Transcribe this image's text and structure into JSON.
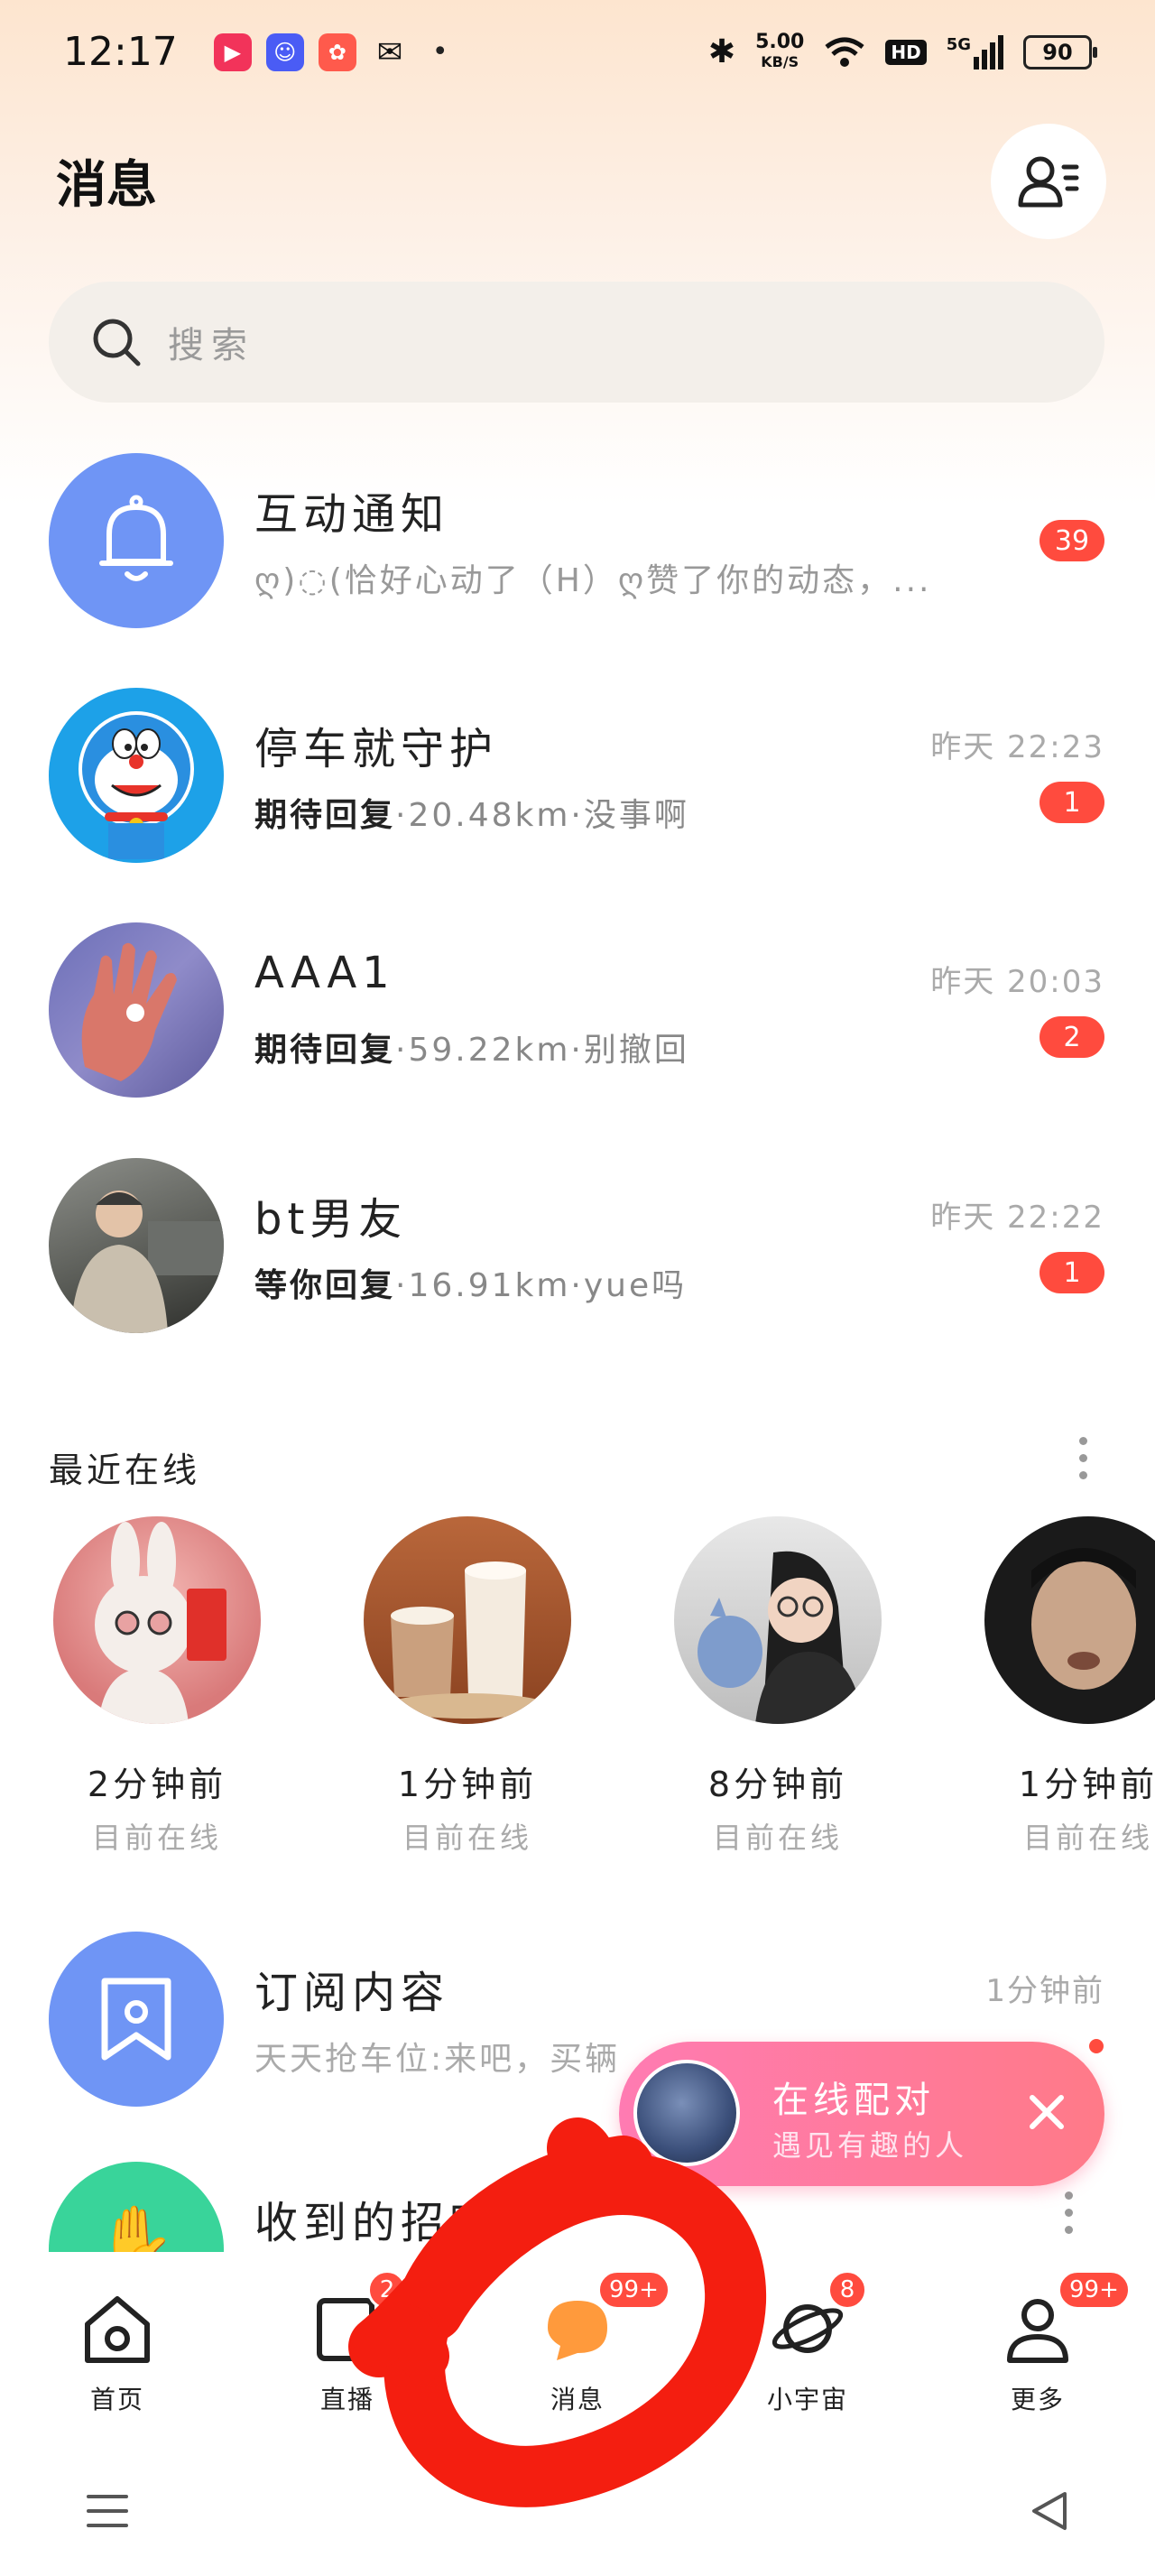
{
  "status_bar": {
    "time": "12:17",
    "net_speed_value": "5.00",
    "net_speed_unit": "KB/S",
    "hd": "HD",
    "signal": "5G",
    "battery": "90",
    "notification_dot": "•"
  },
  "header": {
    "title": "消息",
    "contacts_icon": "contacts-icon"
  },
  "search": {
    "placeholder": "搜索"
  },
  "conversations": [
    {
      "name": "互动通知",
      "preview": "ღ)◌(恰好心动了（H）ღ赞了你的动态，...",
      "time": "",
      "unread": "39",
      "avatar_icon": "bell-icon",
      "avatar_color": "#6f95f5"
    },
    {
      "name": "停车就守护",
      "preview_bold": "期待回复",
      "preview": "·20.48km·没事啊",
      "time": "昨天 22:23",
      "unread": "1"
    },
    {
      "name": "AAA1",
      "preview_bold": "期待回复",
      "preview": "·59.22km·别撤回",
      "time": "昨天 20:03",
      "unread": "2"
    },
    {
      "name": "bt男友",
      "preview_bold": "等你回复",
      "preview": "·16.91km·yue吗",
      "time": "昨天 22:22",
      "unread": "1"
    }
  ],
  "recent_online": {
    "title": "最近在线",
    "users": [
      {
        "time": "2分钟前",
        "status": "目前在线"
      },
      {
        "time": "1分钟前",
        "status": "目前在线"
      },
      {
        "time": "8分钟前",
        "status": "目前在线"
      },
      {
        "time": "1分钟前",
        "status": "目前在线"
      }
    ]
  },
  "subscriptions": {
    "name": "订阅内容",
    "preview": "天天抢车位:来吧，买辆",
    "time": "1分钟前",
    "avatar_color": "#6f95f5"
  },
  "greetings": {
    "name": "收到的招呼",
    "avatar_color": "#39d49a"
  },
  "match_popup": {
    "title": "在线配对",
    "subtitle": "遇见有趣的人"
  },
  "bottom_nav": [
    {
      "label": "首页",
      "icon": "home-icon",
      "badge": ""
    },
    {
      "label": "直播",
      "icon": "live-icon",
      "badge": "2"
    },
    {
      "label": "消息",
      "icon": "message-icon",
      "badge": "99+"
    },
    {
      "label": "小宇宙",
      "icon": "planet-icon",
      "badge": "8"
    },
    {
      "label": "更多",
      "icon": "profile-icon",
      "badge": "99+"
    }
  ],
  "colors": {
    "accent": "#ff4b3e",
    "brand_orange": "#ff9a3c",
    "scribble_red": "#f41e10"
  }
}
